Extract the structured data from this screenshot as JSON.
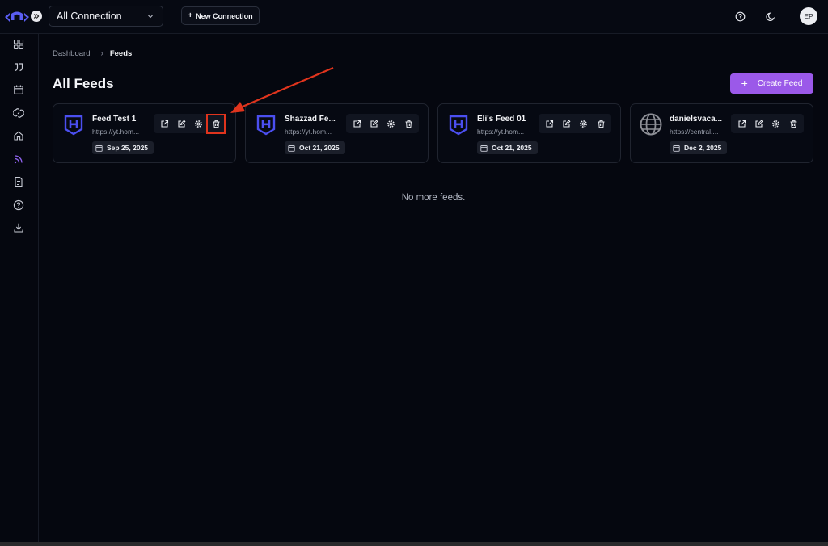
{
  "topbar": {
    "connection_select": "All Connection",
    "new_connection_label": "New Connection",
    "avatar_initials": "EP"
  },
  "sidebar": {
    "items": [
      {
        "icon": "dashboard-grid-icon"
      },
      {
        "icon": "quote-icon"
      },
      {
        "icon": "calendar-icon"
      },
      {
        "icon": "link-icon"
      },
      {
        "icon": "home-icon"
      },
      {
        "icon": "rss-feed-icon",
        "active": true
      },
      {
        "icon": "document-icon"
      },
      {
        "icon": "help-circle-icon"
      },
      {
        "icon": "download-icon"
      }
    ]
  },
  "breadcrumb": {
    "parent": "Dashboard",
    "current": "Feeds"
  },
  "page": {
    "title": "All Feeds",
    "create_label": "Create Feed",
    "empty_message": "No more feeds."
  },
  "feeds": [
    {
      "name": "Feed Test 1",
      "url": "https://yt.hom...",
      "date": "Sep 25, 2025",
      "icon": "shield-h-icon"
    },
    {
      "name": "Shazzad Fe...",
      "url": "https://yt.hom...",
      "date": "Oct 21, 2025",
      "icon": "shield-h-icon"
    },
    {
      "name": "Eli's Feed 01",
      "url": "https://yt.hom...",
      "date": "Oct 21, 2025",
      "icon": "shield-h-icon"
    },
    {
      "name": "danielsvaca...",
      "url": "https://central....",
      "date": "Dec 2, 2025",
      "icon": "globe-icon"
    }
  ],
  "colors": {
    "accent": "#9b59e9",
    "brand_icon": "#4b4ff0",
    "annotation": "#e0341d"
  }
}
